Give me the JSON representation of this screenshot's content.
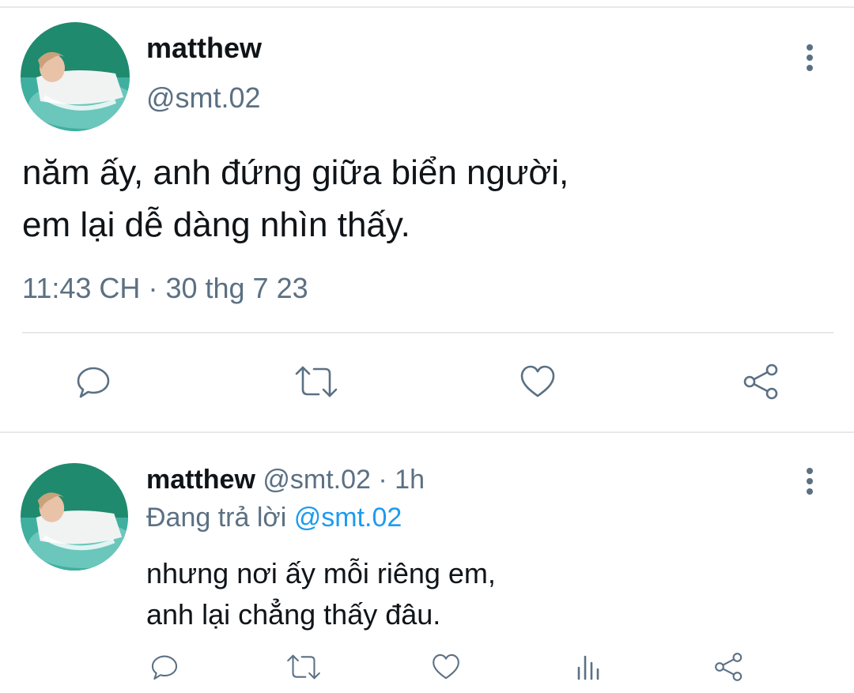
{
  "main_tweet": {
    "author_name": "matthew",
    "handle": "@smt.02",
    "text_lines": [
      "năm ấy, anh đứng giữa biển người,",
      "em lại dễ dàng nhìn thấy."
    ],
    "time": "11:43 CH",
    "separator": "·",
    "date": "30 thg 7 23",
    "actions": [
      "reply-icon",
      "retweet-icon",
      "like-icon",
      "share-icon"
    ]
  },
  "reply_tweet": {
    "author_name": "matthew",
    "handle": "@smt.02",
    "separator": "·",
    "time_ago": "1h",
    "replying_label": "Đang trả lời",
    "replying_to": "@smt.02",
    "text_lines": [
      "nhưng nơi ấy mỗi riêng em,",
      "anh lại chẳng thấy đâu."
    ],
    "actions": [
      "reply-icon",
      "retweet-icon",
      "like-icon",
      "analytics-icon",
      "share-icon"
    ]
  },
  "colors": {
    "text": "#0f1419",
    "secondary": "#5b7083",
    "link": "#1d9bf0",
    "divider": "#e6e9eb"
  }
}
